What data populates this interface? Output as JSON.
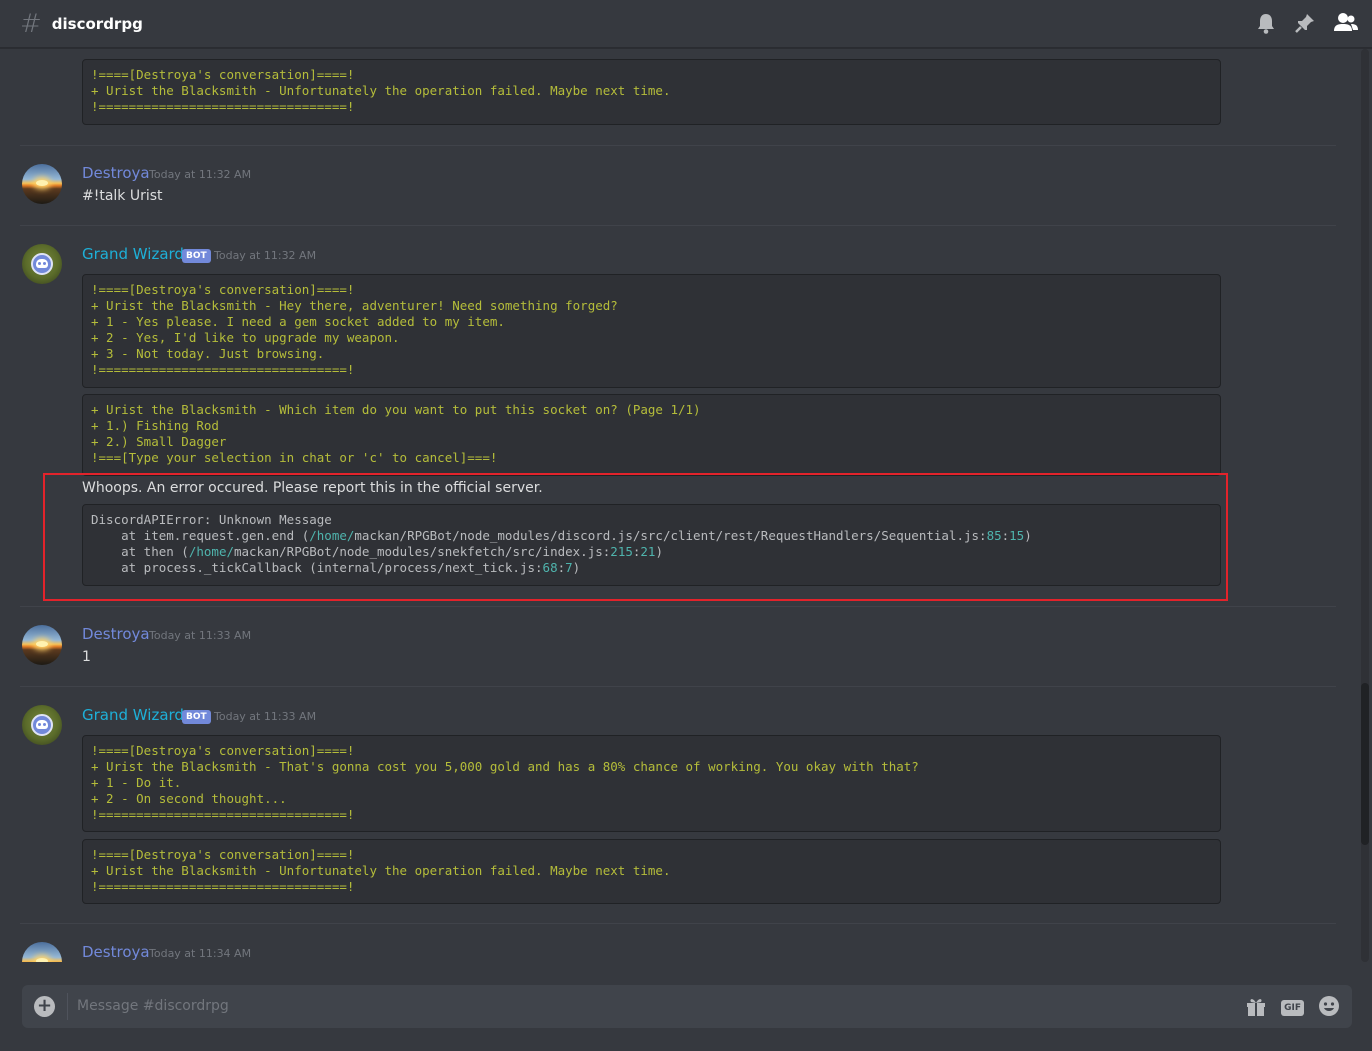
{
  "channel": {
    "name": "discordrpg"
  },
  "messages": {
    "m0": {
      "code": "!====[Destroya's conversation]====!\n+ Urist the Blacksmith - Unfortunately the operation failed. Maybe next time.\n!=================================!"
    },
    "m1": {
      "author": "Destroya",
      "timestamp": "Today at 11:32 AM",
      "text": "#!talk Urist"
    },
    "m2": {
      "author": "Grand Wizard",
      "badge": "BOT",
      "timestamp": "Today at 11:32 AM",
      "code1": "!====[Destroya's conversation]====!\n+ Urist the Blacksmith - Hey there, adventurer! Need something forged?\n+ 1 - Yes please. I need a gem socket added to my item.\n+ 2 - Yes, I'd like to upgrade my weapon.\n+ 3 - Not today. Just browsing.\n!=================================!",
      "code2": "+ Urist the Blacksmith - Which item do you want to put this socket on? (Page 1/1)\n+ 1.) Fishing Rod\n+ 2.) Small Dagger\n!===[Type your selection in chat or 'c' to cancel]===!",
      "error_text": "Whoops. An error occured. Please report this in the official server.",
      "error": {
        "l1": "DiscordAPIError: Unknown Message",
        "l2a": "    at item.request.gen.end (",
        "l2b": "/home/",
        "l2c": "mackan/RPGBot/node_modules/discord.js/src/client/rest/RequestHandlers/Sequential.js:",
        "l2d": "85",
        "l2e": ":",
        "l2f": "15",
        "l2g": ")",
        "l3a": "    at then (",
        "l3b": "/home/",
        "l3c": "mackan/RPGBot/node_modules/snekfetch/src/index.js:",
        "l3d": "215",
        "l3e": ":",
        "l3f": "21",
        "l3g": ")",
        "l4a": "    at process._tickCallback (internal/process/next_tick.js:",
        "l4b": "68",
        "l4c": ":",
        "l4d": "7",
        "l4e": ")"
      }
    },
    "m3": {
      "author": "Destroya",
      "timestamp": "Today at 11:33 AM",
      "text": "1"
    },
    "m4": {
      "author": "Grand Wizard",
      "badge": "BOT",
      "timestamp": "Today at 11:33 AM",
      "code1": "!====[Destroya's conversation]====!\n+ Urist the Blacksmith - That's gonna cost you 5,000 gold and has a 80% chance of working. You okay with that?\n+ 1 - Do it.\n+ 2 - On second thought...\n!=================================!",
      "code2": "!====[Destroya's conversation]====!\n+ Urist the Blacksmith - Unfortunately the operation failed. Maybe next time.\n!=================================!"
    },
    "m5": {
      "author": "Destroya",
      "timestamp": "Today at 11:34 AM"
    }
  },
  "composer": {
    "placeholder": "Message #discordrpg",
    "gif_label": "GIF"
  },
  "colors": {
    "background": "#36393f",
    "codeblock": "#2f3136",
    "code_text": "#b5bd3a",
    "blurple": "#7289da",
    "bot_name": "#1eb0d8",
    "highlight": "#e3232b"
  },
  "icons": [
    "hash-icon",
    "bell-icon",
    "pin-icon",
    "members-icon",
    "plus-icon",
    "gift-icon",
    "gif-icon",
    "emoji-icon"
  ]
}
